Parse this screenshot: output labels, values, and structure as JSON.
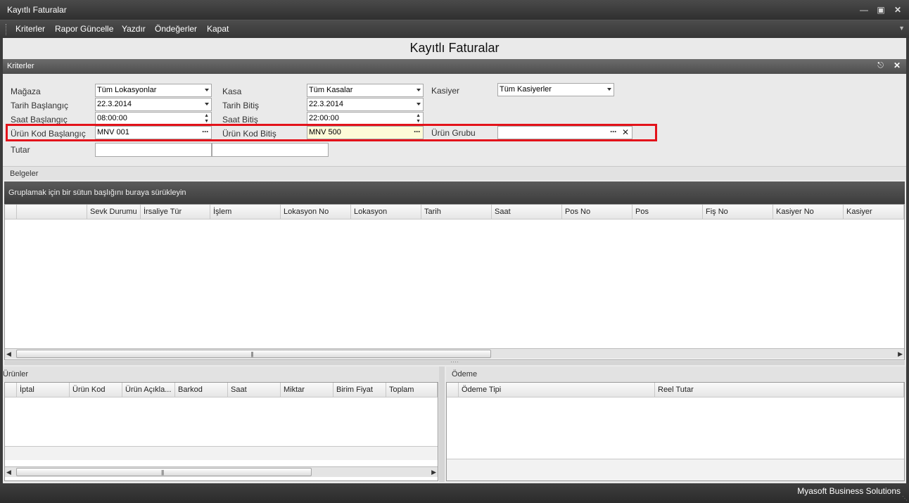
{
  "window": {
    "title": "Kayıtlı Faturalar"
  },
  "menu": {
    "items": [
      "Kriterler",
      "Rapor Güncelle",
      "Yazdır",
      "Öndeğerler",
      "Kapat"
    ]
  },
  "report_title": "Kayıtlı Faturalar",
  "criteria_panel": {
    "title": "Kriterler",
    "labels": {
      "magaza": "Mağaza",
      "tarih_baslangic": "Tarih Başlangıç",
      "saat_baslangic": "Saat Başlangıç",
      "urun_kod_baslangic": "Ürün Kod Başlangıç",
      "tutar": "Tutar",
      "kasa": "Kasa",
      "tarih_bitis": "Tarih Bitiş",
      "saat_bitis": "Saat Bitiş",
      "urun_kod_bitis": "Ürün Kod Bitiş",
      "kasiyer": "Kasiyer",
      "urun_grubu": "Ürün Grubu"
    },
    "values": {
      "magaza": "Tüm Lokasyonlar",
      "tarih_baslangic": "22.3.2014",
      "saat_baslangic": "08:00:00",
      "urun_kod_baslangic": "MNV 001",
      "tutar_min": "",
      "tutar_max": "",
      "kasa": "Tüm Kasalar",
      "tarih_bitis": "22.3.2014",
      "saat_bitis": "22:00:00",
      "urun_kod_bitis": "MNV 500",
      "kasiyer": "Tüm Kasiyerler",
      "urun_grubu": ""
    }
  },
  "belgeler": {
    "title": "Belgeler",
    "group_hint": "Gruplamak için bir sütun başlığını buraya sürükleyin",
    "columns": [
      "Sevk Durumu",
      "İrsaliye Tür",
      "İşlem",
      "Lokasyon No",
      "Lokasyon",
      "Tarih",
      "Saat",
      "Pos No",
      "Pos",
      "Fiş No",
      "Kasiyer No",
      "Kasiyer"
    ],
    "rows": []
  },
  "urunler": {
    "title": "Ürünler",
    "columns": [
      "İptal",
      "Ürün Kod",
      "Ürün Açıkla...",
      "Barkod",
      "Saat",
      "Miktar",
      "Birim Fiyat",
      "Toplam"
    ],
    "rows": []
  },
  "odeme": {
    "title": "Ödeme",
    "columns": [
      "Ödeme Tipi",
      "Reel Tutar"
    ],
    "rows": []
  },
  "status": {
    "brand": "Myasoft Business Solutions"
  },
  "icons": {
    "minimize": "minimize-icon",
    "maximize": "maximize-icon",
    "close": "close-icon",
    "pin": "pin-icon"
  }
}
